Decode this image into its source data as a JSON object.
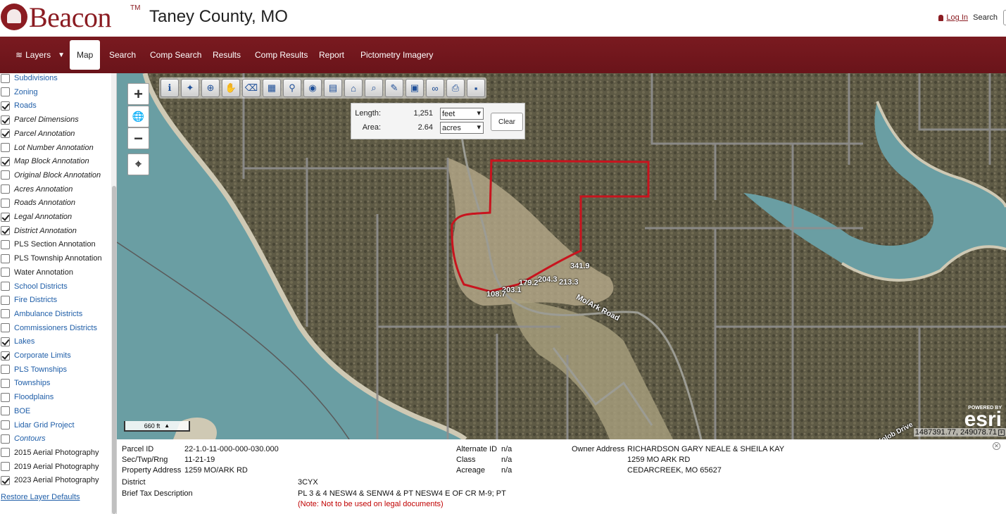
{
  "header": {
    "logo_text": "Beacon",
    "trademark": "TM",
    "county": "Taney County, MO",
    "login_label": "Log In",
    "search_label": "Search"
  },
  "nav": {
    "layers": "Layers",
    "items": [
      "Map",
      "Search",
      "Comp Search",
      "Results",
      "Comp Results",
      "Report",
      "Pictometry Imagery"
    ]
  },
  "sidebar": {
    "layers": [
      {
        "label": "Subdivisions",
        "checked": false,
        "style": "blue"
      },
      {
        "label": "Zoning",
        "checked": false,
        "style": "blue"
      },
      {
        "label": "Roads",
        "checked": true,
        "style": "blue"
      },
      {
        "label": "Parcel Dimensions",
        "checked": true,
        "style": "italic"
      },
      {
        "label": "Parcel Annotation",
        "checked": true,
        "style": "italic"
      },
      {
        "label": "Lot Number Annotation",
        "checked": false,
        "style": "italic"
      },
      {
        "label": "Map Block Annotation",
        "checked": true,
        "style": "italic"
      },
      {
        "label": "Original Block Annotation",
        "checked": false,
        "style": "italic"
      },
      {
        "label": "Acres Annotation",
        "checked": false,
        "style": "italic"
      },
      {
        "label": "Roads Annotation",
        "checked": false,
        "style": "italic"
      },
      {
        "label": "Legal Annotation",
        "checked": true,
        "style": "italic"
      },
      {
        "label": "District Annotation",
        "checked": true,
        "style": "italic"
      },
      {
        "label": "PLS Section Annotation",
        "checked": false,
        "style": "plain"
      },
      {
        "label": "PLS Township Annotation",
        "checked": false,
        "style": "plain"
      },
      {
        "label": "Water Annotation",
        "checked": false,
        "style": "plain"
      },
      {
        "label": "School Districts",
        "checked": false,
        "style": "blue"
      },
      {
        "label": "Fire Districts",
        "checked": false,
        "style": "blue"
      },
      {
        "label": "Ambulance Districts",
        "checked": false,
        "style": "blue"
      },
      {
        "label": "Commissioners Districts",
        "checked": false,
        "style": "blue"
      },
      {
        "label": "Lakes",
        "checked": true,
        "style": "blue"
      },
      {
        "label": "Corporate Limits",
        "checked": true,
        "style": "blue"
      },
      {
        "label": "PLS Townships",
        "checked": false,
        "style": "blue"
      },
      {
        "label": "Townships",
        "checked": false,
        "style": "blue"
      },
      {
        "label": "Floodplains",
        "checked": false,
        "style": "blue"
      },
      {
        "label": "BOE",
        "checked": false,
        "style": "blue"
      },
      {
        "label": "Lidar Grid Project",
        "checked": false,
        "style": "blue"
      },
      {
        "label": "Contours",
        "checked": false,
        "style": "blueitalic"
      },
      {
        "label": "2015 Aerial Photography",
        "checked": false,
        "style": "plain"
      },
      {
        "label": "2019 Aerial Photography",
        "checked": false,
        "style": "plain"
      },
      {
        "label": "2023 Aerial Photography",
        "checked": true,
        "style": "plain"
      }
    ],
    "restore_label": "Restore Layer Defaults"
  },
  "map": {
    "zoom_in": "+",
    "zoom_out": "−",
    "toolbar_icons": [
      "info-icon",
      "identify-icon",
      "zoom-in-icon",
      "pan-icon",
      "eraser-icon",
      "select-icon",
      "pin-icon",
      "photo-icon",
      "layers-map-icon",
      "buffer-icon",
      "magnify-icon",
      "pencil-icon",
      "print-preview-icon",
      "binoculars-icon",
      "print-icon",
      "save-icon"
    ],
    "measure": {
      "length_label": "Length:",
      "length_value": "1,251",
      "length_unit": "feet",
      "area_label": "Area:",
      "area_value": "2.64",
      "area_unit": "acres",
      "clear_label": "Clear"
    },
    "dimensions": [
      "341.9",
      "204.3",
      "213.3",
      "179.2",
      "203.1",
      "108.7"
    ],
    "road_label": "Mo/Ark Road",
    "road_label_2": "Kolob Drive",
    "scale_label": "660 ft",
    "esri_powered": "POWERED BY",
    "esri_name": "esri",
    "coordinates": "1487391.77, 249078.71"
  },
  "info": {
    "parcel_id_label": "Parcel ID",
    "parcel_id": "22-1.0-11-000-000-030.000",
    "str_label": "Sec/Twp/Rng",
    "str_value": "11-21-19",
    "address_label": "Property Address",
    "address_value": "1259 MO/ARK RD",
    "district_label": "District",
    "district_value": "3CYX",
    "tax_label": "Brief Tax Description",
    "tax_value": "PL 3 & 4 NESW4 & SENW4 & PT NESW4 E OF CR M-9; PT",
    "tax_note": "(Note: Not to be used on legal documents)",
    "alt_id_label": "Alternate ID",
    "alt_id_value": "n/a",
    "class_label": "Class",
    "class_value": "n/a",
    "acreage_label": "Acreage",
    "acreage_value": "n/a",
    "owner_label": "Owner Address",
    "owner_line1": "RICHARDSON GARY NEALE & SHEILA KAY",
    "owner_line2": "1259 MO ARK RD",
    "owner_line3": "CEDARCREEK, MO 65627"
  }
}
